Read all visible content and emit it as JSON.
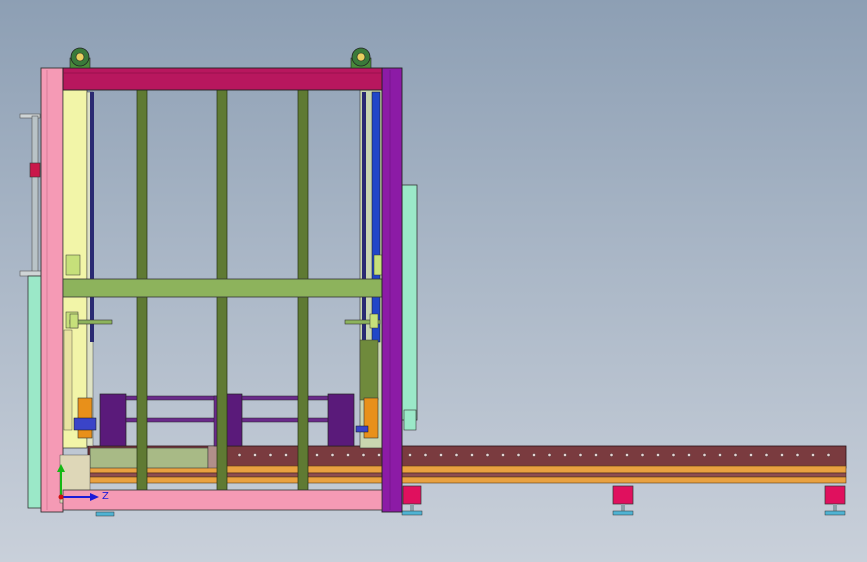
{
  "colors": {
    "background_top": "#8d9fb4",
    "background_bottom": "#c9d0da",
    "frame_pink": "#f59ab5",
    "top_beam_crimson": "#b8175e",
    "right_column_purple": "#8c1ba6",
    "green_bar": "#8db35c",
    "olive_column": "#5f7a33",
    "conveyor_brown": "#7a3b3f",
    "conveyor_orange": "#e9a140",
    "foot_magenta": "#e0105e",
    "cabinet_mint": "#9be8c8",
    "cabinet_yellow": "#f2f5a8",
    "box_purple": "#5a1a7a",
    "cylinder_orange": "#e8901a",
    "cylinder_blue": "#2146c8"
  },
  "axis_triad": {
    "z_label": "Z",
    "x_color": "#1b1bd8",
    "y_color": "#14b814",
    "z_color": "#1b1bd8"
  }
}
